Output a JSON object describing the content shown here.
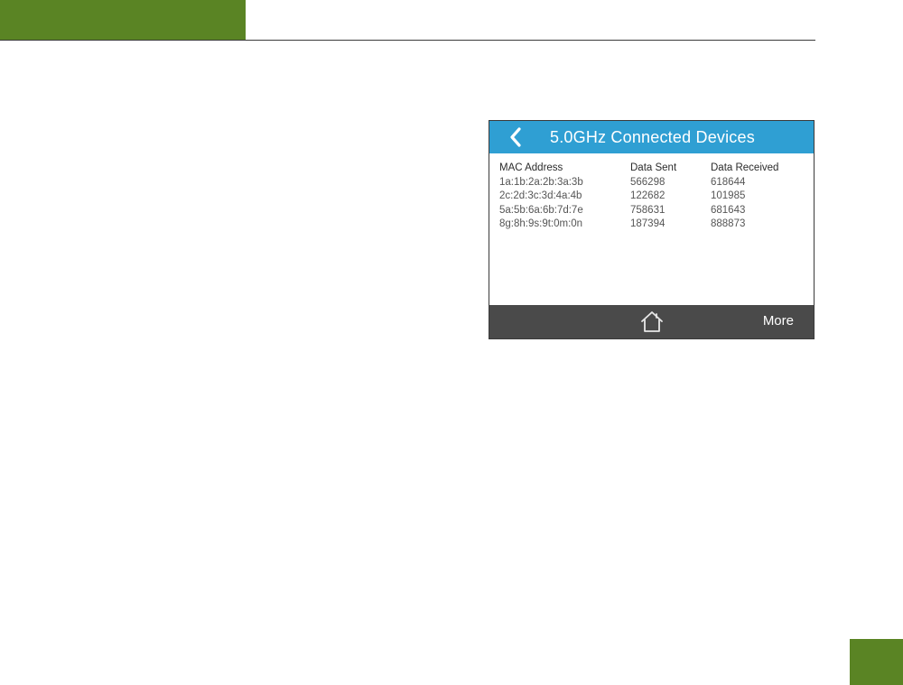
{
  "colors": {
    "header_green": "#5a8424",
    "title_bar_blue": "#2f9fd3",
    "bottom_bar_gray": "#4a4a4a"
  },
  "screen": {
    "title": "5.0GHz Connected Devices",
    "back_icon": "chevron-left-icon",
    "table": {
      "headers": [
        "MAC Address",
        "Data Sent",
        "Data Received"
      ],
      "rows": [
        [
          "1a:1b:2a:2b:3a:3b",
          "566298",
          "618644"
        ],
        [
          "2c:2d:3c:3d:4a:4b",
          "122682",
          "101985"
        ],
        [
          "5a:5b:6a:6b:7d:7e",
          "758631",
          "681643"
        ],
        [
          "8g:8h:9s:9t:0m:0n",
          "187394",
          "888873"
        ]
      ]
    },
    "bottom_bar": {
      "home_icon": "home-icon",
      "more_label": "More"
    }
  }
}
